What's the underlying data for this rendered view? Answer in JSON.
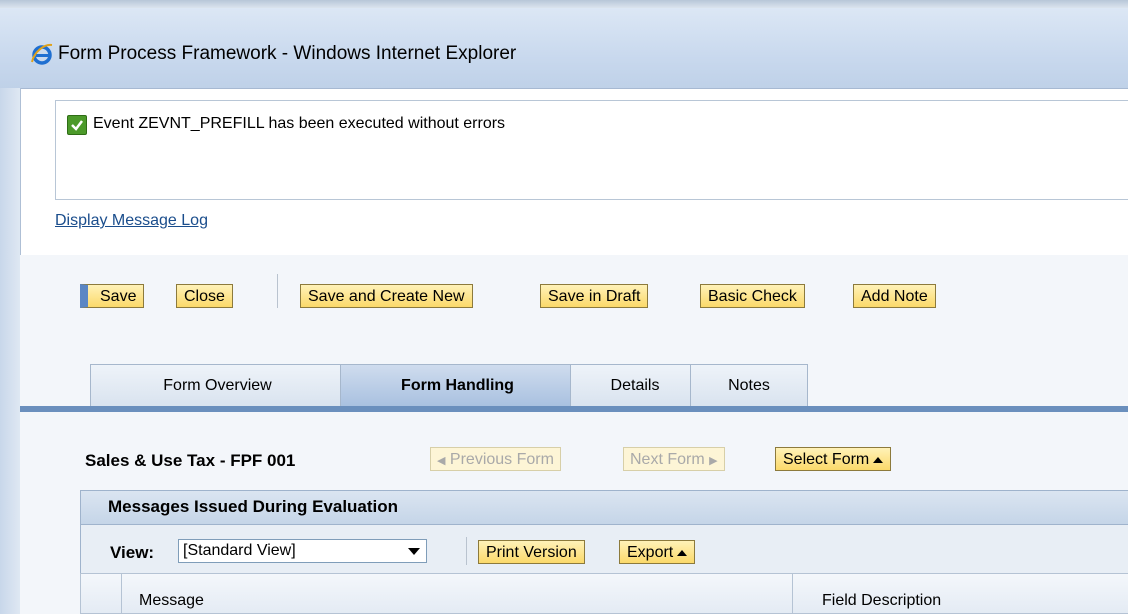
{
  "window": {
    "title": "Form Process Framework - Windows Internet Explorer",
    "icon": "ie-icon"
  },
  "message_area": {
    "status_icon": "checkmark-icon",
    "message": "Event ZEVNT_PREFILL has been executed without errors",
    "log_link": "Display Message Log"
  },
  "toolbar": {
    "save": "Save",
    "close": "Close",
    "save_create_new": "Save and Create New",
    "save_draft": "Save in Draft",
    "basic_check": "Basic Check",
    "add_note": "Add Note"
  },
  "tabs": [
    {
      "label": "Form Overview",
      "active": false
    },
    {
      "label": "Form Handling",
      "active": true
    },
    {
      "label": "Details",
      "active": false
    },
    {
      "label": "Notes",
      "active": false
    }
  ],
  "form": {
    "title": "Sales & Use Tax - FPF 001",
    "previous": "Previous Form",
    "next": "Next Form",
    "select": "Select Form"
  },
  "messages_tray": {
    "title": "Messages Issued During Evaluation",
    "view_label": "View:",
    "view_value": "[Standard View]",
    "print_version": "Print Version",
    "export": "Export",
    "columns": [
      "Message",
      "Field Description"
    ]
  },
  "colors": {
    "accent": "#6a8fbd",
    "button_bg": "#fbd96a",
    "success": "#4c9a2a",
    "link": "#1a4d8c"
  }
}
